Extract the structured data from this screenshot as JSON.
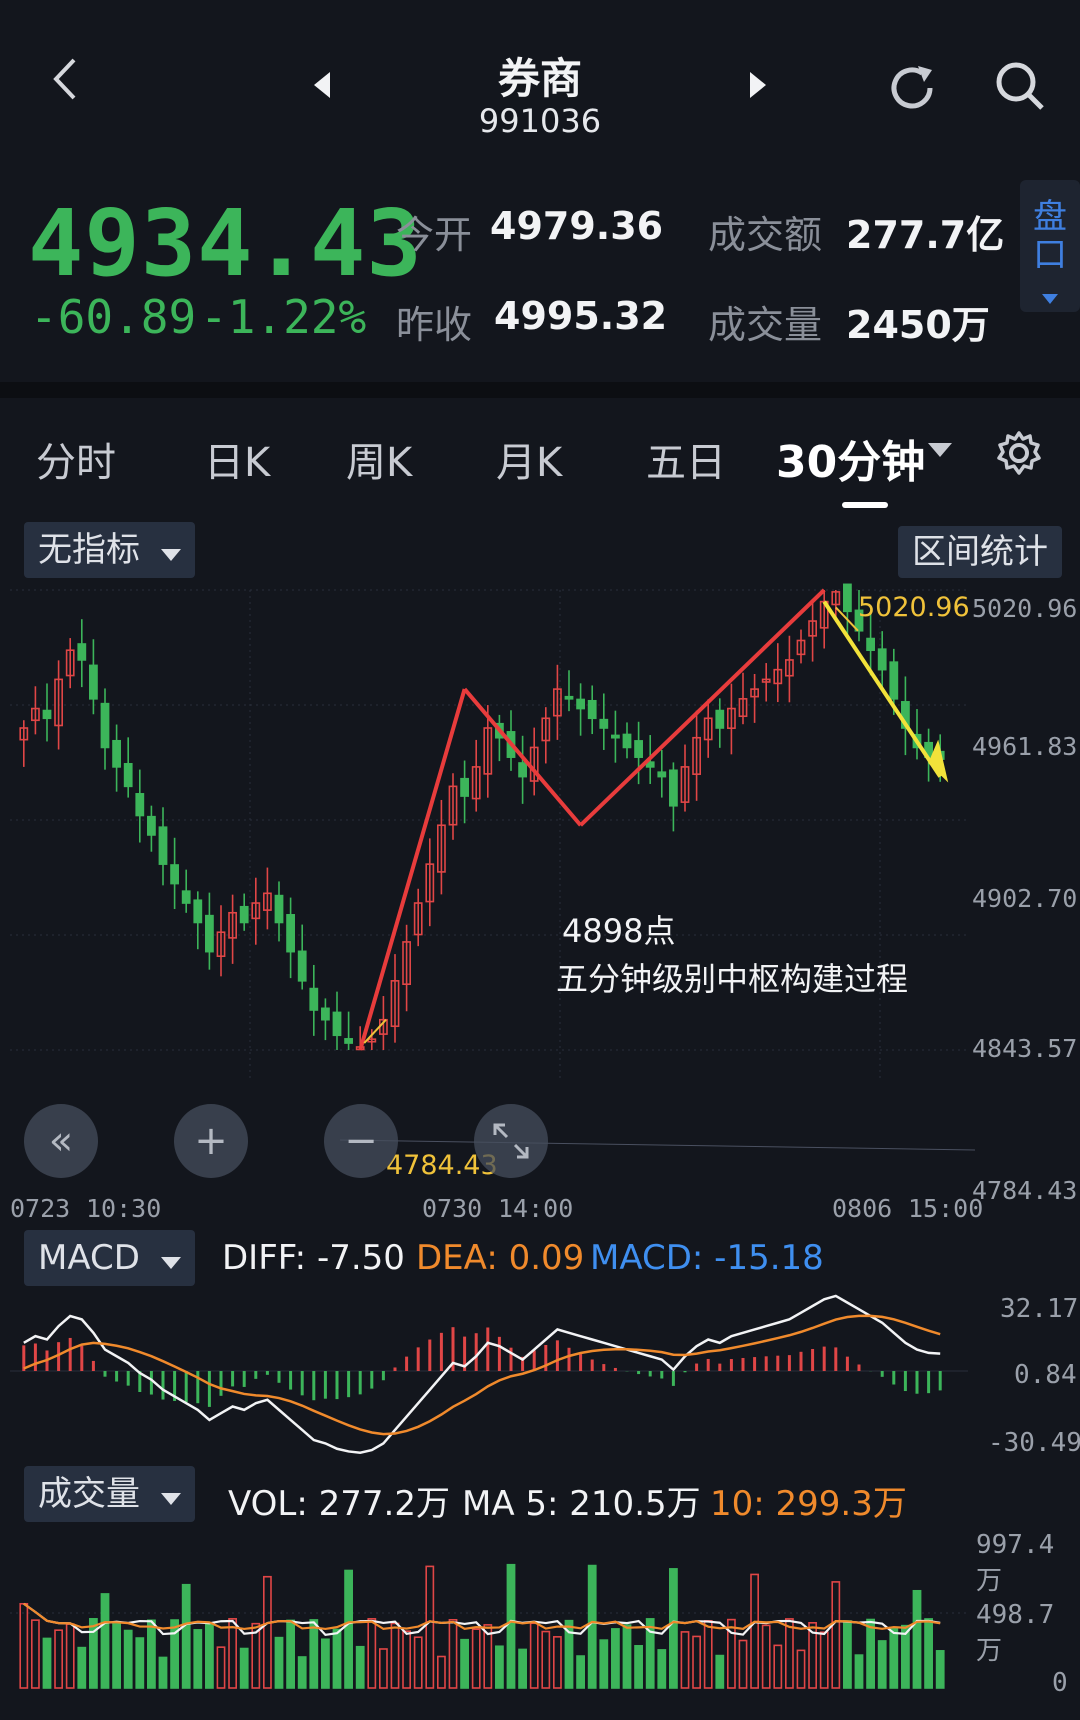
{
  "header": {
    "title": "券商",
    "code": "991036",
    "back_icon": "chevron-left-icon",
    "prev_icon": "triangle-left-icon",
    "next_icon": "triangle-right-icon",
    "refresh_icon": "refresh-icon",
    "search_icon": "search-icon"
  },
  "quote": {
    "price": "4934.43",
    "change": "-60.89",
    "change_pct": "-1.22%",
    "open_label": "今开",
    "open_value": "4979.36",
    "prev_close_label": "昨收",
    "prev_close_value": "4995.32",
    "amount_label": "成交额",
    "amount_value": "277.7亿",
    "volume_label": "成交量",
    "volume_value": "2450万",
    "pankou_label_1": "盘",
    "pankou_label_2": "口",
    "up_color": "#e04646",
    "down_color": "#3cb55a"
  },
  "tabs": [
    "分时",
    "日K",
    "周K",
    "月K",
    "五日",
    "30分钟"
  ],
  "active_tab": "30分钟",
  "toolbar": {
    "indicator_select": "无指标",
    "range_stats": "区间统计"
  },
  "main_chart": {
    "y_ticks": [
      "5020.96",
      "4961.83",
      "4902.70",
      "4843.57",
      "4784.43"
    ],
    "x_ticks": [
      "0723",
      "10:30",
      "0730",
      "14:00",
      "0806",
      "15:00"
    ],
    "high_marker": "5020.96",
    "low_marker": "4784.43",
    "annotation_1": "4898点",
    "annotation_2": "五分钟级别中枢构建过程"
  },
  "macd": {
    "select": "MACD",
    "diff": "DIFF: -7.50",
    "dea": "DEA: 0.09",
    "macd": "MACD: -15.18",
    "y_ticks": [
      "32.17",
      "0.84",
      "-30.49"
    ]
  },
  "volume": {
    "select": "成交量",
    "vol": "VOL: 277.2万",
    "ma5": "MA 5: 210.5万",
    "ma10": "10: 299.3万",
    "y_ticks": [
      "997.4万",
      "498.7万",
      "0"
    ]
  },
  "chart_data": {
    "type": "candlestick",
    "title": "",
    "xlabel": "",
    "ylabel": "",
    "ylim": [
      4784.43,
      5020.96
    ],
    "x_ticks": [
      "0723",
      "10:30",
      "0730",
      "14:00",
      "0806",
      "15:00"
    ],
    "y_ticks": [
      5020.96,
      4961.83,
      4902.7,
      4843.57,
      4784.43
    ],
    "approx_close": [
      4950,
      4960,
      4955,
      4975,
      4990,
      4985,
      4965,
      4940,
      4930,
      4920,
      4905,
      4895,
      4880,
      4870,
      4860,
      4850,
      4835,
      4845,
      4855,
      4850,
      4860,
      4865,
      4850,
      4835,
      4820,
      4805,
      4800,
      4792,
      4788,
      4786,
      4790,
      4800,
      4820,
      4840,
      4860,
      4880,
      4900,
      4920,
      4915,
      4930,
      4950,
      4945,
      4935,
      4925,
      4940,
      4955,
      4970,
      4965,
      4960,
      4955,
      4950,
      4945,
      4940,
      4935,
      4930,
      4925,
      4910,
      4930,
      4945,
      4955,
      4950,
      4960,
      4965,
      4970,
      4975,
      4980,
      4985,
      4995,
      5005,
      5015,
      5020,
      5010,
      5000,
      4990,
      4980,
      4965,
      4950,
      4940,
      4935,
      4934
    ],
    "macd_ylim": [
      -30.49,
      32.17
    ],
    "volume_ylim": [
      0,
      997.4
    ],
    "volume_unit": "万"
  }
}
